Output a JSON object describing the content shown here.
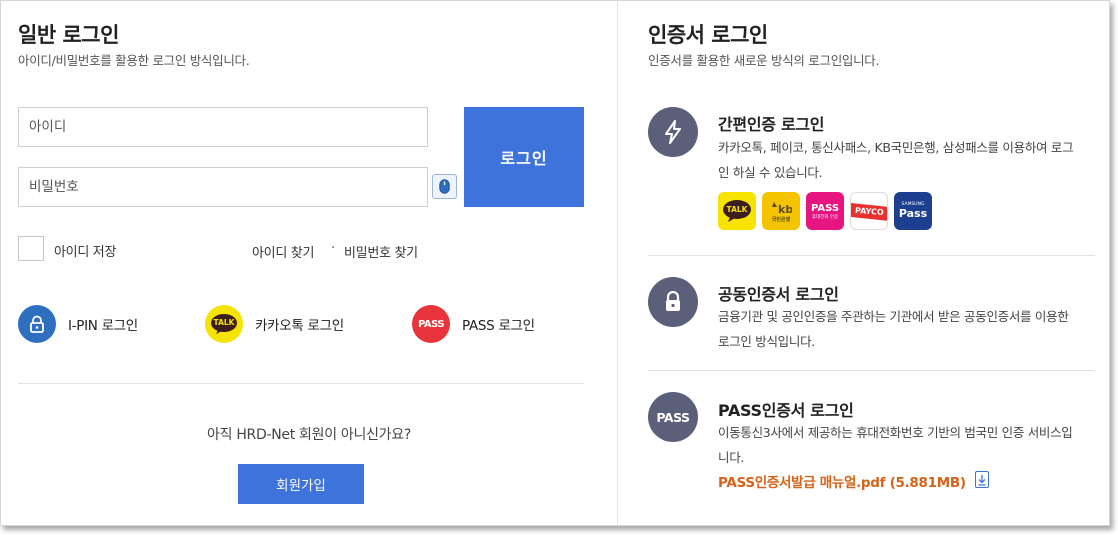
{
  "general_login": {
    "title": "일반 로그인",
    "subtitle": "아이디/비밀번호를 활용한 로그인 방식입니다.",
    "id_placeholder": "아이디",
    "password_placeholder": "비밀번호",
    "login_label": "로그인",
    "save_id_label": "아이디 저장",
    "find_id_label": "아이디 찾기",
    "separator": "·",
    "find_password_label": "비밀번호 찾기"
  },
  "alt_logins": [
    {
      "label": "I-PIN 로그인",
      "icon": "lock-icon",
      "color": "#2f6fc0"
    },
    {
      "label": "카카오톡 로그인",
      "icon": "kakaotalk-icon",
      "icon_text": "TALK",
      "color": "#f7e300"
    },
    {
      "label": "PASS 로그인",
      "icon": "pass-icon",
      "icon_text": "PASS",
      "color": "#e8343a"
    }
  ],
  "signup": {
    "question": "아직 HRD-Net 회원이 아니신가요?",
    "button_label": "회원가입"
  },
  "cert_login": {
    "title": "인증서 로그인",
    "subtitle": "인증서를 활용한 새로운 방식의 로그인입니다.",
    "simple": {
      "title": "간편인증 로그인",
      "desc": "카카오톡, 페이코, 통신사패스, KB국민은행, 삼성패스를 이용하여 로그인 하실 수 있습니다.",
      "logos": [
        {
          "name": "kakao",
          "text": "TALK",
          "bg": "#f7e300",
          "fg": "#3c1e1e"
        },
        {
          "name": "kb",
          "text": "국민은행",
          "bg": "#f5c400",
          "fg": "#5a4a1a"
        },
        {
          "name": "pass",
          "text": "PASS",
          "subtext": "휴대전화 인증",
          "bg": "#e6157f",
          "fg": "#ffffff"
        },
        {
          "name": "payco",
          "text": "PAYCO",
          "bg": "#ffffff",
          "fg": "#ffffff"
        },
        {
          "name": "samsung-pass",
          "text": "Pass",
          "subtext": "SAMSUNG",
          "bg": "#1d3f8f",
          "fg": "#ffffff"
        }
      ]
    },
    "joint": {
      "title": "공동인증서 로그인",
      "desc": "금융기관 및 공인인증을 주관하는 기관에서 받은 공동인증서를 이용한 로그인 방식입니다."
    },
    "pass": {
      "title": "PASS인증서 로그인",
      "icon_text": "PASS",
      "desc": "이동통신3사에서 제공하는 휴대전화번호 기반의 범국민 인증 서비스입니다.",
      "manual_link": "PASS인증서발급 매뉴얼.pdf (5.881MB)"
    }
  }
}
